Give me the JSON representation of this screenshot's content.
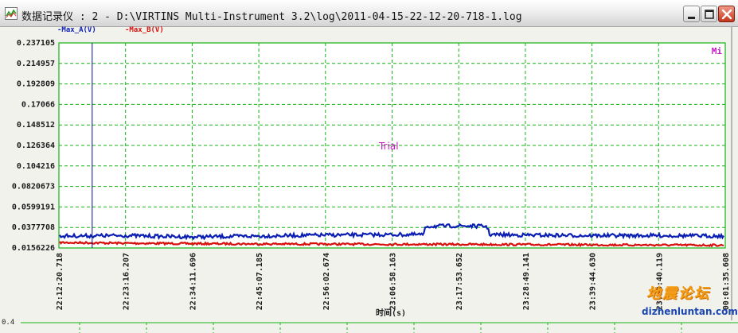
{
  "window": {
    "title": "数据记录仪 : 2 - D:\\VIRTINS Multi-Instrument 3.2\\log\\2011-04-15-22-12-20-718-1.log",
    "buttons": [
      "minimize-icon",
      "maximize-icon",
      "close-icon"
    ]
  },
  "legend": {
    "a": "-Max_A(V)",
    "b": "-Max_B(V)"
  },
  "corner_label": "Mi",
  "trial_text": "Trial",
  "watermark": {
    "cn": "地震论坛",
    "url": "dizhenluntan.com"
  },
  "bottom_axis_value": "0.4",
  "colors": {
    "series_a": "#0a1eb4",
    "series_b": "#d8100c",
    "grid": "#14b414",
    "plot_border": "#14b414",
    "cursor": "#06108a",
    "trial": "#c418c4"
  },
  "chart_data": {
    "type": "line",
    "xlabel": "时间(s)",
    "ylabel": "",
    "y_ticks": [
      "0.237105",
      "0.214957",
      "0.192809",
      "0.17066",
      "0.148512",
      "0.126364",
      "0.104216",
      "0.0820673",
      "0.0599191",
      "0.0377708",
      "0.0156226"
    ],
    "x_ticks": [
      "22:12:20.718",
      "22:23:16.207",
      "22:34:11.696",
      "22:45:07.185",
      "22:56:02.674",
      "23:06:58.163",
      "23:17:53.652",
      "23:28:49.141",
      "23:39:44.630",
      "23:50:40.119",
      "00:01:35.608"
    ],
    "ylim": [
      0.0156226,
      0.237105
    ],
    "xlim": [
      "22:12:20.718",
      "00:01:35.608"
    ],
    "grid": true,
    "cursor_x": "22:17:48",
    "series": [
      {
        "name": "Max_A(V)",
        "x": [
          "22:12:20.718",
          "22:23:16.207",
          "22:34:11.696",
          "22:45:07.185",
          "22:56:02.674",
          "23:06:58.163",
          "23:12:10",
          "23:12:30",
          "23:17:53.652",
          "23:22:30",
          "23:23:00",
          "23:28:49.141",
          "23:39:44.630",
          "23:50:40.119",
          "00:01:35.608"
        ],
        "values": [
          0.0285,
          0.029,
          0.0275,
          0.0285,
          0.0295,
          0.03,
          0.03,
          0.039,
          0.0395,
          0.039,
          0.03,
          0.0295,
          0.029,
          0.029,
          0.0285
        ]
      },
      {
        "name": "Max_B(V)",
        "x": [
          "22:12:20.718",
          "22:23:16.207",
          "22:34:11.696",
          "22:45:07.185",
          "22:56:02.674",
          "23:06:58.163",
          "23:17:53.652",
          "23:28:49.141",
          "23:39:44.630",
          "23:50:40.119",
          "00:01:35.608"
        ],
        "values": [
          0.0215,
          0.0208,
          0.0203,
          0.02,
          0.0198,
          0.0196,
          0.0195,
          0.0193,
          0.019,
          0.0188,
          0.0186
        ]
      }
    ]
  }
}
